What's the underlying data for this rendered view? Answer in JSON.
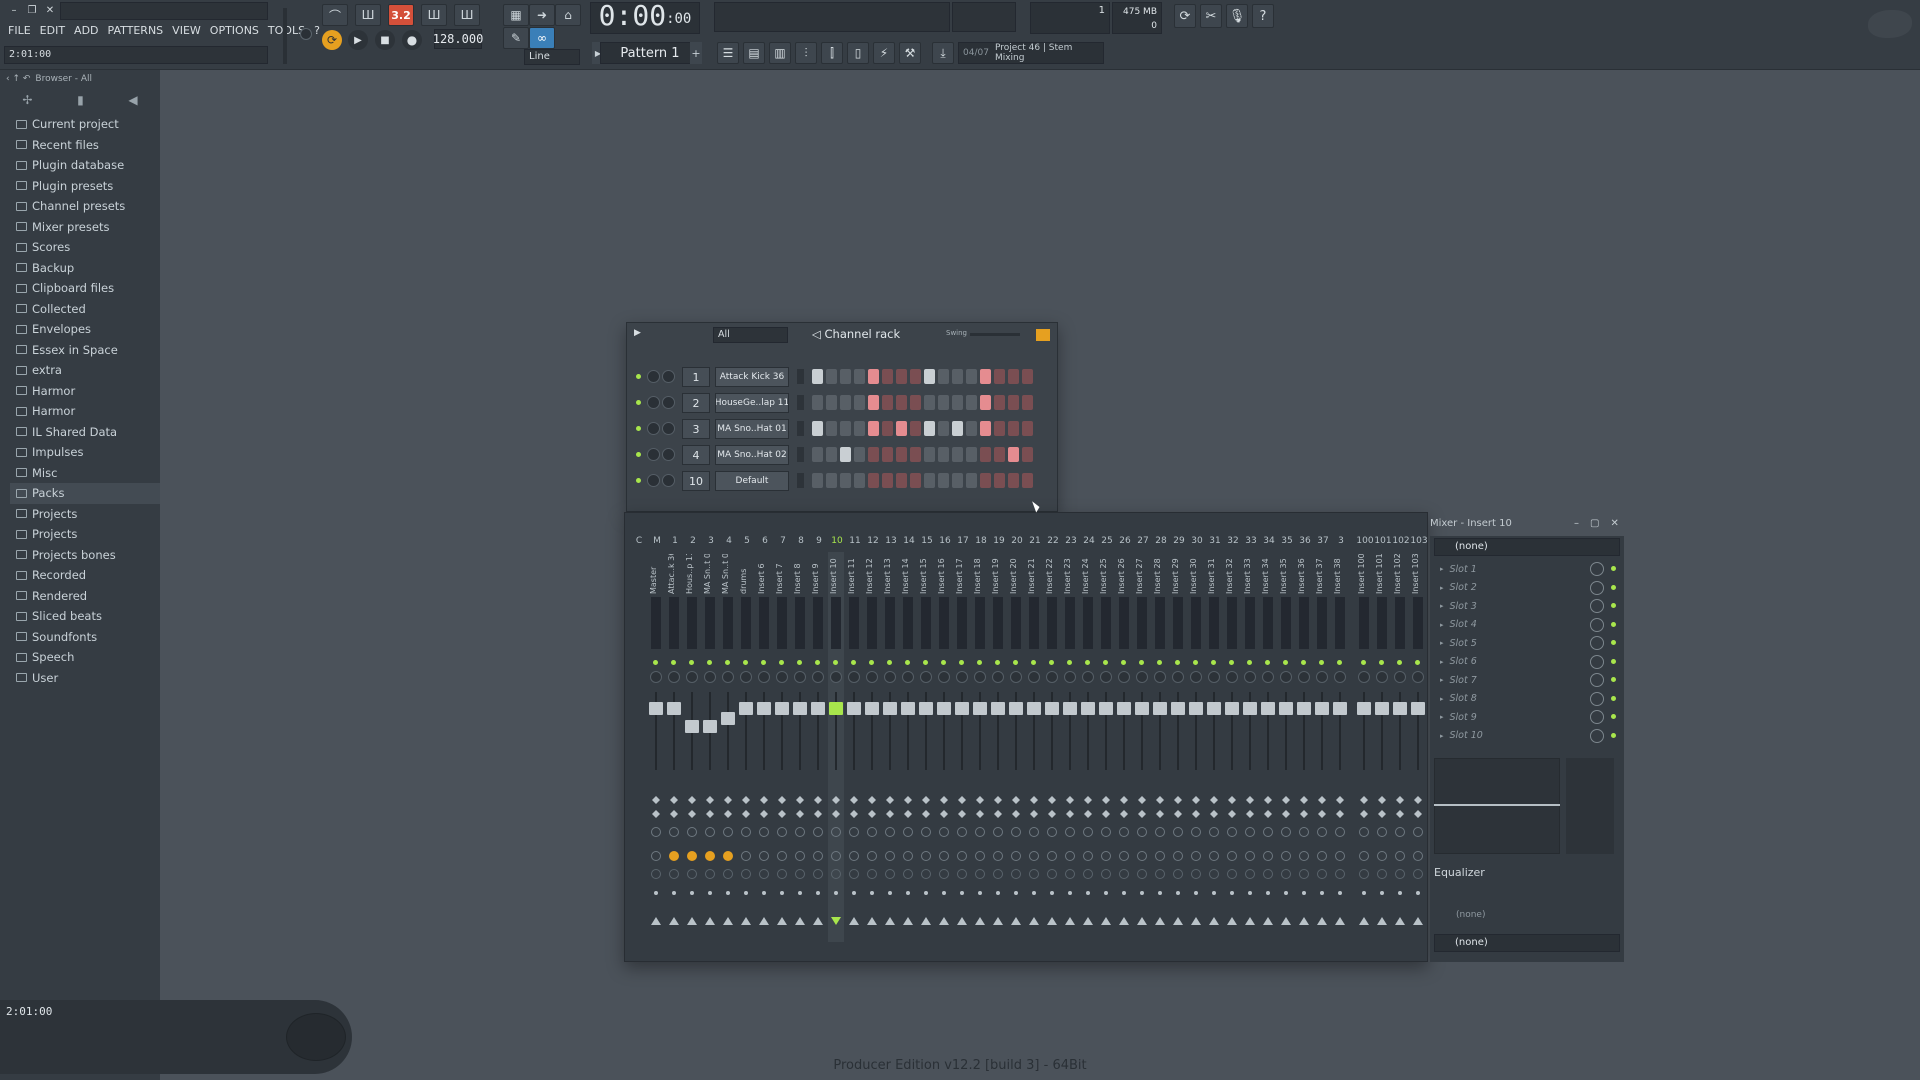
{
  "menu": [
    "FILE",
    "EDIT",
    "ADD",
    "PATTERNS",
    "VIEW",
    "OPTIONS",
    "TOOLS",
    "?"
  ],
  "hint_time": "2:01:00",
  "transport": {
    "pat_mode": "3.2",
    "tempo": "128.000",
    "time_main": "0:00",
    "time_small": ":00",
    "snap": "Line"
  },
  "cpu": "1",
  "memory": "475 MB",
  "memory_sub": "0",
  "pattern": "Pattern 1",
  "hint_bar": {
    "num": "04/07",
    "text": "Project 46 | Stem Mixing"
  },
  "browser": {
    "title": "Browser - All",
    "items": [
      "Current project",
      "Recent files",
      "Plugin database",
      "Plugin presets",
      "Channel presets",
      "Mixer presets",
      "Scores",
      "Backup",
      "Clipboard files",
      "Collected",
      "Envelopes",
      "Essex in Space",
      "extra",
      "Harmor",
      "Harmor",
      "IL Shared Data",
      "Impulses",
      "Misc",
      "Packs",
      "Projects",
      "Projects",
      "Projects bones",
      "Recorded",
      "Rendered",
      "Sliced beats",
      "Soundfonts",
      "Speech",
      "User"
    ],
    "selected_index": 18,
    "bottom_time": "2:01:00"
  },
  "channel_rack": {
    "title": "Channel rack",
    "filter": "All",
    "swing_label": "Swing",
    "channels": [
      {
        "num": "1",
        "name": "Attack Kick 36",
        "steps": [
          1,
          0,
          0,
          0,
          1,
          0,
          0,
          0,
          1,
          0,
          0,
          0,
          1,
          0,
          0,
          0
        ]
      },
      {
        "num": "2",
        "name": "HouseGe..lap 11",
        "steps": [
          0,
          0,
          0,
          0,
          1,
          0,
          0,
          0,
          0,
          0,
          0,
          0,
          1,
          0,
          0,
          0
        ]
      },
      {
        "num": "3",
        "name": "MA Sno..Hat 01",
        "steps": [
          1,
          0,
          0,
          0,
          1,
          0,
          1,
          0,
          1,
          0,
          1,
          0,
          1,
          0,
          0,
          0
        ]
      },
      {
        "num": "4",
        "name": "MA Sno..Hat 02",
        "steps": [
          0,
          0,
          1,
          0,
          0,
          0,
          0,
          0,
          0,
          0,
          0,
          0,
          0,
          0,
          1,
          0
        ]
      },
      {
        "num": "10",
        "name": "Default",
        "steps": [
          0,
          0,
          0,
          0,
          0,
          0,
          0,
          0,
          0,
          0,
          0,
          0,
          0,
          0,
          0,
          0
        ]
      }
    ]
  },
  "mixer": {
    "title": "Mixer - Insert 10",
    "track_numbers": [
      "C",
      "M",
      "1",
      "2",
      "3",
      "4",
      "5",
      "6",
      "7",
      "8",
      "9",
      "10",
      "11",
      "12",
      "13",
      "14",
      "15",
      "16",
      "17",
      "18",
      "19",
      "20",
      "21",
      "22",
      "23",
      "24",
      "25",
      "26",
      "27",
      "28",
      "29",
      "30",
      "31",
      "32",
      "33",
      "34",
      "35",
      "36",
      "37",
      "3",
      "100",
      "101",
      "102",
      "103"
    ],
    "track_names": [
      "Master",
      "Attac..k 36",
      "Hous..p 11",
      "MA Sn..t 01",
      "MA Sn..t 02",
      "drums",
      "Insert 6",
      "Insert 7",
      "Insert 8",
      "Insert 9",
      "Insert 10",
      "Insert 11",
      "Insert 12",
      "Insert 13",
      "Insert 14",
      "Insert 15",
      "Insert 16",
      "Insert 17",
      "Insert 18",
      "Insert 19",
      "Insert 20",
      "Insert 21",
      "Insert 22",
      "Insert 23",
      "Insert 24",
      "Insert 25",
      "Insert 26",
      "Insert 27",
      "Insert 28",
      "Insert 29",
      "Insert 30",
      "Insert 31",
      "Insert 32",
      "Insert 33",
      "Insert 34",
      "Insert 35",
      "Insert 36",
      "Insert 37",
      "Insert 38",
      "Insert 100",
      "Insert 101",
      "Insert 102",
      "Insert 103"
    ],
    "selected_track": "10",
    "preset": "(none)",
    "slots": [
      "Slot 1",
      "Slot 2",
      "Slot 3",
      "Slot 4",
      "Slot 5",
      "Slot 6",
      "Slot 7",
      "Slot 8",
      "Slot 9",
      "Slot 10"
    ],
    "eq_label": "Equalizer",
    "eq_none": "(none)",
    "out_preset": "(none)"
  },
  "footer": "Producer Edition v12.2 [build 3] - 64Bit"
}
